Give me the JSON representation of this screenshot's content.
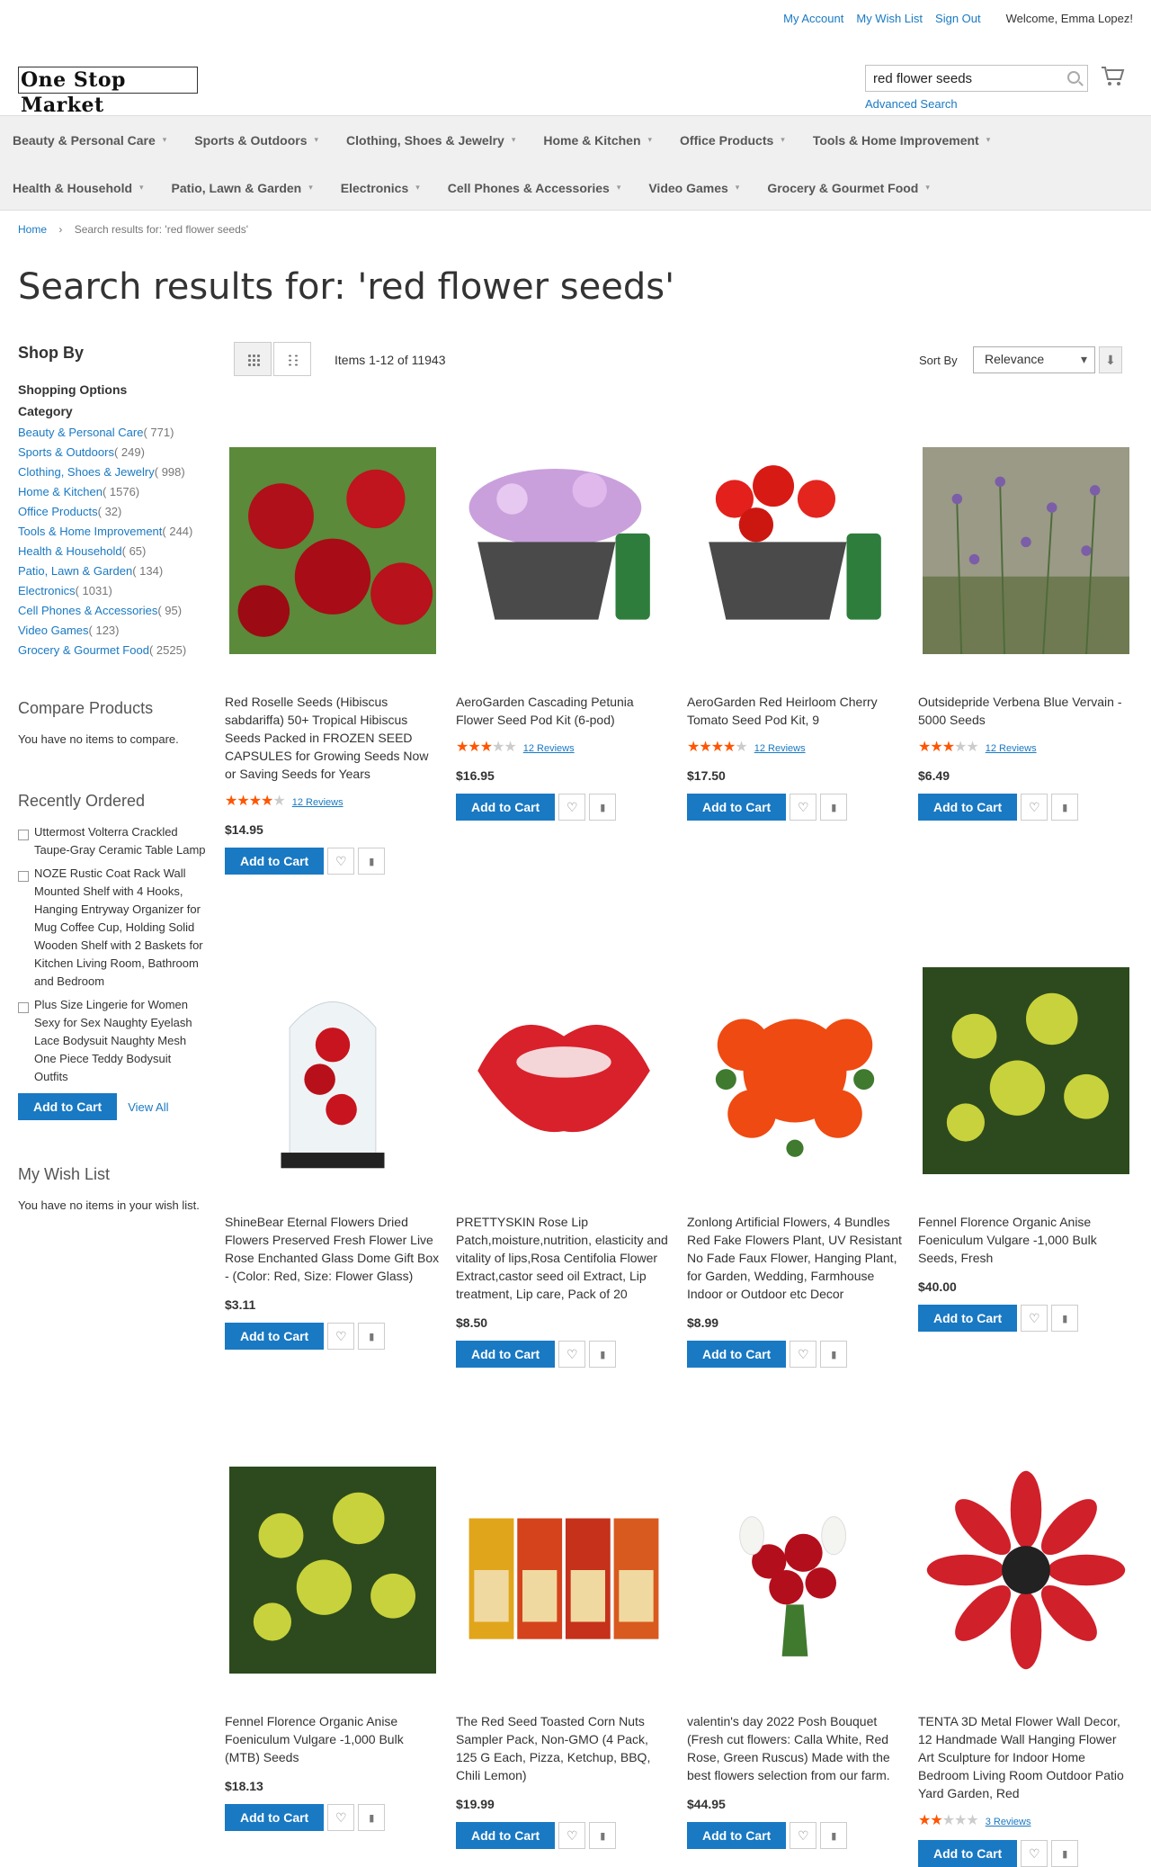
{
  "top_links": {
    "my_account": "My Account",
    "my_wish_list": "My Wish List",
    "sign_out": "Sign Out",
    "welcome": "Welcome, Emma Lopez!"
  },
  "header": {
    "logo_text": "One Stop Market",
    "search_value": "red flower seeds",
    "advanced_search": "Advanced Search"
  },
  "nav": {
    "row1": [
      "Beauty & Personal Care",
      "Sports & Outdoors",
      "Clothing, Shoes & Jewelry",
      "Home & Kitchen",
      "Office Products",
      "Tools & Home Improvement"
    ],
    "row2": [
      "Health & Household",
      "Patio, Lawn & Garden",
      "Electronics",
      "Cell Phones & Accessories",
      "Video Games",
      "Grocery & Gourmet Food"
    ]
  },
  "breadcrumb": {
    "home": "Home",
    "current": "Search results for: 'red flower seeds'"
  },
  "page_title": "Search results for: 'red flower seeds'",
  "toolbar": {
    "amount": "Items 1-12 of 11943",
    "sort_label": "Sort By",
    "sort_value": "Relevance"
  },
  "sidebar": {
    "shop_by": "Shop By",
    "shopping_options": "Shopping Options",
    "category_label": "Category",
    "categories": [
      {
        "label": "Beauty & Personal Care",
        "count": "( 771)"
      },
      {
        "label": "Sports & Outdoors",
        "count": "( 249)"
      },
      {
        "label": "Clothing, Shoes & Jewelry",
        "count": "( 998)"
      },
      {
        "label": "Home & Kitchen",
        "count": "( 1576)"
      },
      {
        "label": "Office Products",
        "count": "( 32)"
      },
      {
        "label": "Tools & Home Improvement",
        "count": "( 244)"
      },
      {
        "label": "Health & Household",
        "count": "( 65)"
      },
      {
        "label": "Patio, Lawn & Garden",
        "count": "( 134)"
      },
      {
        "label": "Electronics",
        "count": "( 1031)"
      },
      {
        "label": "Cell Phones & Accessories",
        "count": "( 95)"
      },
      {
        "label": "Video Games",
        "count": "( 123)"
      },
      {
        "label": "Grocery & Gourmet Food",
        "count": "( 2525)"
      }
    ],
    "compare_title": "Compare Products",
    "compare_text": "You have no items to compare.",
    "recent_title": "Recently Ordered",
    "recent_items": [
      "Uttermost Volterra Crackled Taupe-Gray Ceramic Table Lamp",
      "NOZE Rustic Coat Rack Wall Mounted Shelf with 4 Hooks, Hanging Entryway Organizer for Mug Coffee Cup, Holding Solid Wooden Shelf with 2 Baskets for Kitchen Living Room, Bathroom and Bedroom",
      "Plus Size Lingerie for Women Sexy for Sex Naughty Eyelash Lace Bodysuit Naughty Mesh One Piece Teddy Bodysuit Outfits"
    ],
    "add_to_cart": "Add to Cart",
    "view_all": "View All",
    "wishlist_title": "My Wish List",
    "wishlist_text": "You have no items in your wish list."
  },
  "products": [
    {
      "name": "Red Roselle Seeds (Hibiscus sabdariffa) 50+ Tropical Hibiscus Seeds Packed in FROZEN SEED CAPSULES for Growing Seeds Now or Saving Seeds for Years",
      "rating": 0.8,
      "reviews": "12  Reviews",
      "price": "$14.95",
      "img": "hibiscus"
    },
    {
      "name": "AeroGarden Cascading Petunia Flower Seed Pod Kit (6-pod)",
      "rating": 0.6,
      "reviews": "12  Reviews",
      "price": "$16.95",
      "img": "petunia"
    },
    {
      "name": "AeroGarden Red Heirloom Cherry Tomato Seed Pod Kit, 9",
      "rating": 0.7,
      "reviews": "12  Reviews",
      "price": "$17.50",
      "img": "tomato"
    },
    {
      "name": "Outsidepride Verbena Blue Vervain - 5000 Seeds",
      "rating": 0.6,
      "reviews": "12  Reviews",
      "price": "$6.49",
      "img": "verbena"
    },
    {
      "name": "ShineBear Eternal Flowers Dried Flowers Preserved Fresh Flower Live Rose Enchanted Glass Dome Gift Box - (Color: Red, Size: Flower Glass)",
      "rating": null,
      "reviews": "",
      "price": "$3.11",
      "img": "rosedome"
    },
    {
      "name": "PRETTYSKIN Rose Lip Patch,moisture,nutrition, elasticity and vitality of lips,Rosa Centifolia Flower Extract,castor seed oil Extract, Lip treatment, Lip care, Pack of 20",
      "rating": null,
      "reviews": "",
      "price": "$8.50",
      "img": "lips"
    },
    {
      "name": "Zonlong Artificial Flowers, 4 Bundles Red Fake Flowers Plant, UV Resistant No Fade Faux Flower, Hanging Plant, for Garden, Wedding, Farmhouse Indoor or Outdoor etc Decor",
      "rating": null,
      "reviews": "",
      "price": "$8.99",
      "img": "orange"
    },
    {
      "name": "Fennel Florence Organic Anise Foeniculum Vulgare -1,000 Bulk Seeds, Fresh",
      "rating": null,
      "reviews": "",
      "price": "$40.00",
      "img": "fennel"
    },
    {
      "name": "Fennel Florence Organic Anise Foeniculum Vulgare -1,000 Bulk (MTB) Seeds",
      "rating": null,
      "reviews": "",
      "price": "$18.13",
      "img": "fennel"
    },
    {
      "name": "The Red Seed Toasted Corn Nuts Sampler Pack, Non-GMO (4 Pack, 125 G Each, Pizza, Ketchup, BBQ, Chili Lemon)",
      "rating": null,
      "reviews": "",
      "price": "$19.99",
      "img": "snacks"
    },
    {
      "name": "valentin's day 2022 Posh Bouquet (Fresh cut flowers: Calla White, Red Rose, Green Ruscus) Made with the best flowers selection from our farm.",
      "rating": null,
      "reviews": "",
      "price": "$44.95",
      "img": "bouquet"
    },
    {
      "name": "TENTA 3D Metal Flower Wall Decor, 12 Handmade Wall Hanging Flower Art Sculpture for Indoor Home Bedroom Living Room Outdoor Patio Yard Garden, Red",
      "rating": 0.4,
      "reviews": "3  Reviews",
      "price": "",
      "img": "metal"
    }
  ],
  "product_add_to_cart": "Add to Cart",
  "colors": {
    "accent": "#1979c3",
    "star": "#ff5501"
  }
}
